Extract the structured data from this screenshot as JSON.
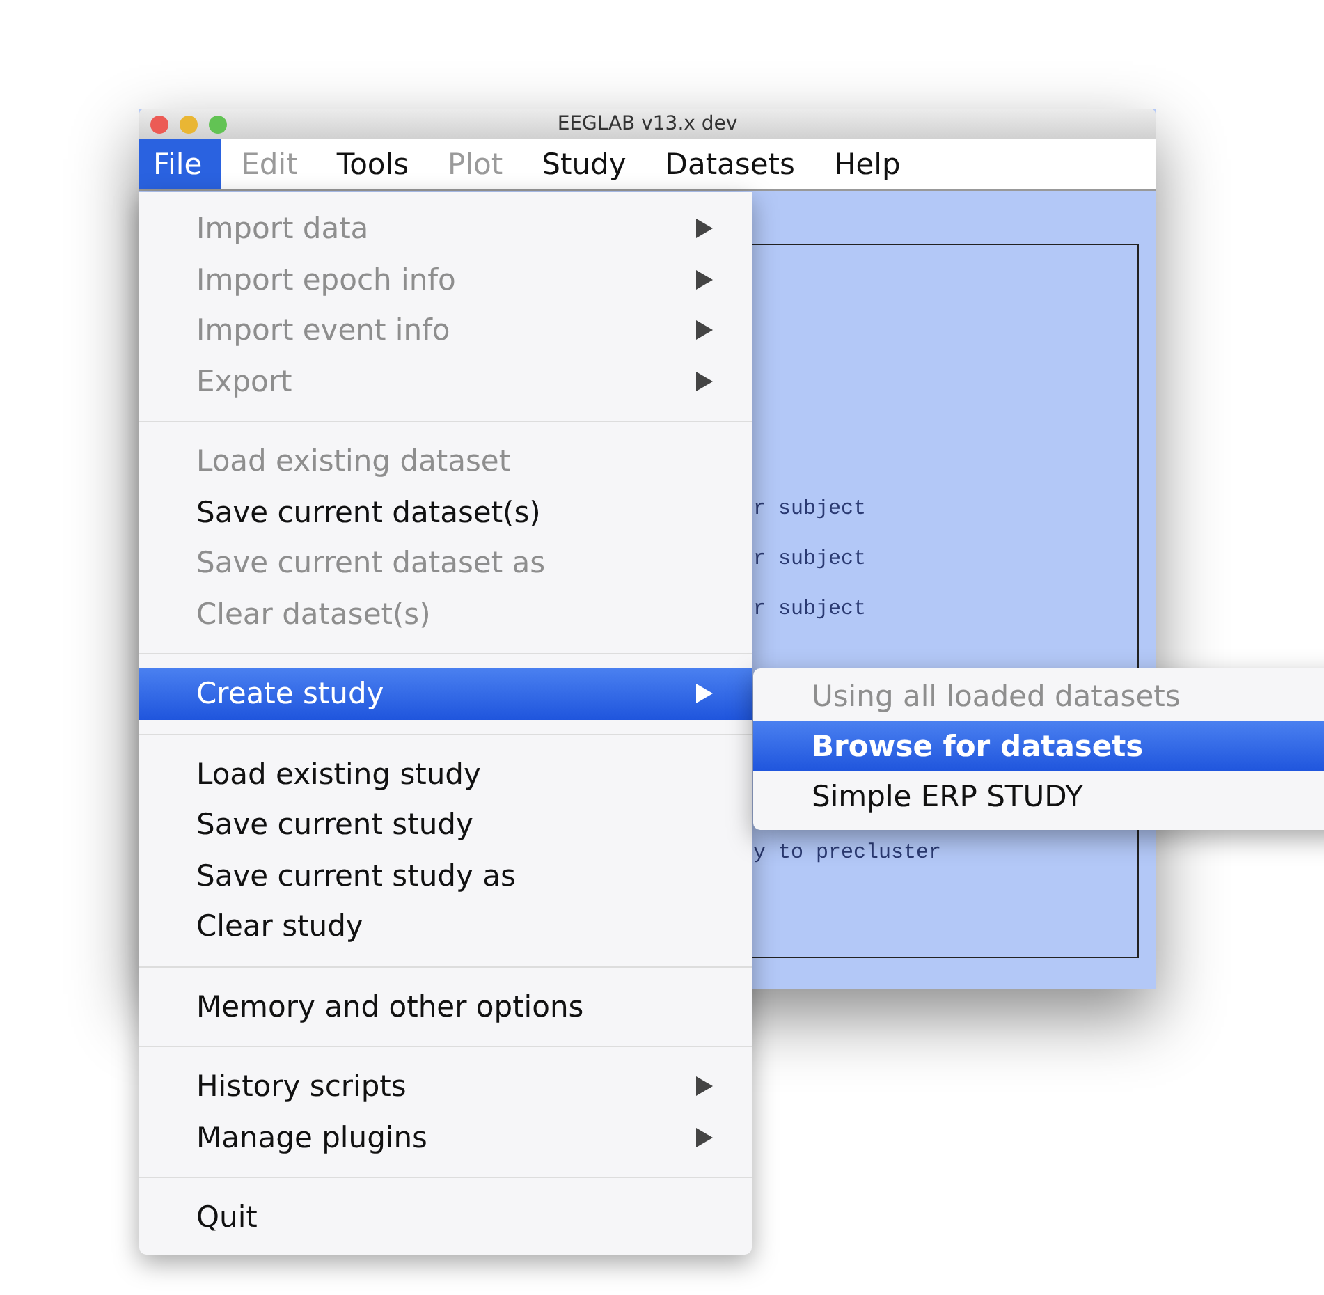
{
  "window": {
    "title": "EEGLAB v13.x dev"
  },
  "menu_bar": [
    {
      "label": "File",
      "selected": true,
      "disabled": false
    },
    {
      "label": "Edit",
      "selected": false,
      "disabled": true
    },
    {
      "label": "Tools",
      "selected": false,
      "disabled": false
    },
    {
      "label": "Plot",
      "selected": false,
      "disabled": true
    },
    {
      "label": "Study",
      "selected": false,
      "disabled": false
    },
    {
      "label": "Datasets",
      "selected": false,
      "disabled": false
    },
    {
      "label": "Help",
      "selected": false,
      "disabled": false
    }
  ],
  "background_lines": [
    "r subject",
    "r subject",
    "r subject",
    "y to precluster"
  ],
  "file_menu": [
    [
      {
        "label": "Import data",
        "disabled": true,
        "submenu": true,
        "selected": false
      },
      {
        "label": "Import epoch info",
        "disabled": true,
        "submenu": true,
        "selected": false
      },
      {
        "label": "Import event info",
        "disabled": true,
        "submenu": true,
        "selected": false
      },
      {
        "label": "Export",
        "disabled": true,
        "submenu": true,
        "selected": false
      }
    ],
    [
      {
        "label": "Load existing dataset",
        "disabled": true,
        "submenu": false,
        "selected": false
      },
      {
        "label": "Save current dataset(s)",
        "disabled": false,
        "submenu": false,
        "selected": false
      },
      {
        "label": "Save current dataset as",
        "disabled": true,
        "submenu": false,
        "selected": false
      },
      {
        "label": "Clear dataset(s)",
        "disabled": true,
        "submenu": false,
        "selected": false
      }
    ],
    [
      {
        "label": "Create study",
        "disabled": false,
        "submenu": true,
        "selected": true
      }
    ],
    [
      {
        "label": "Load existing study",
        "disabled": false,
        "submenu": false,
        "selected": false
      },
      {
        "label": "Save current study",
        "disabled": false,
        "submenu": false,
        "selected": false
      },
      {
        "label": "Save current study as",
        "disabled": false,
        "submenu": false,
        "selected": false
      },
      {
        "label": "Clear study",
        "disabled": false,
        "submenu": false,
        "selected": false
      }
    ],
    [
      {
        "label": "Memory and other options",
        "disabled": false,
        "submenu": false,
        "selected": false
      }
    ],
    [
      {
        "label": "History scripts",
        "disabled": false,
        "submenu": true,
        "selected": false
      },
      {
        "label": "Manage plugins",
        "disabled": false,
        "submenu": true,
        "selected": false
      }
    ],
    [
      {
        "label": "Quit",
        "disabled": false,
        "submenu": false,
        "selected": false
      }
    ]
  ],
  "create_study_submenu": [
    {
      "label": "Using all loaded datasets",
      "disabled": true,
      "selected": false
    },
    {
      "label": "Browse for datasets",
      "disabled": false,
      "selected": true
    },
    {
      "label": "Simple ERP STUDY",
      "disabled": false,
      "selected": false
    }
  ]
}
